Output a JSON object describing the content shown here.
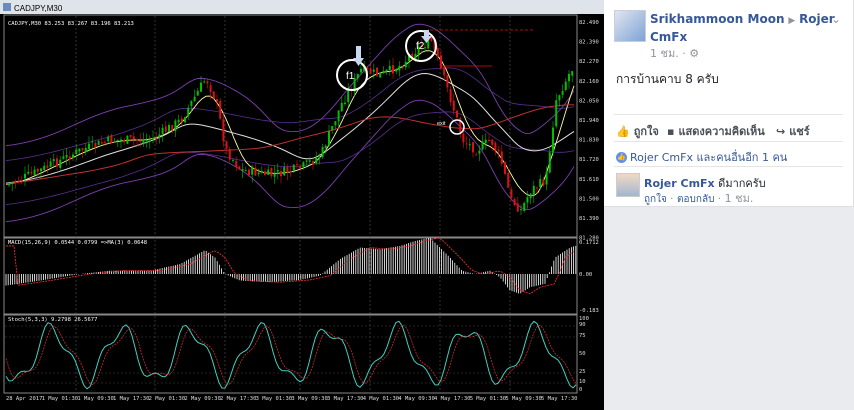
{
  "chart": {
    "window_title": "CADJPY,M30",
    "price_header": "CADJPY,M30 83.253 83.267 83.196 83.213",
    "price_axis": [
      "82.490",
      "82.390",
      "82.270",
      "82.160",
      "82.050",
      "81.940",
      "81.830",
      "81.720",
      "81.610",
      "81.500",
      "81.390",
      "81.280"
    ],
    "macd_label": "MACD(15,26,9) 0.0544 0.0799 =>MA(3) 0.0648",
    "macd_axis": [
      "0.1712",
      "0.00",
      "-0.183"
    ],
    "stoch_label": "Stoch(5,3,3) 9.2798 26.5677",
    "stoch_axis": [
      "100",
      "90",
      "75",
      "50",
      "25",
      "10",
      "0"
    ],
    "time_axis": [
      "28 Apr 2017",
      "1 May 01:30",
      "1 May 09:30",
      "1 May 17:30",
      "2 May 01:30",
      "2 May 09:30",
      "2 May 17:30",
      "3 May 01:30",
      "3 May 09:30",
      "3 May 17:30",
      "4 May 01:30",
      "4 May 09:30",
      "4 May 17:30",
      "5 May 01:30",
      "5 May 09:30",
      "5 May 17:30"
    ],
    "annotations": {
      "f1": "f1",
      "f2": "f2",
      "exit": "exit"
    },
    "colors": {
      "bull": "#00c000",
      "bear": "#e01010",
      "macd": "#ffffff",
      "stoch": "#40d0c0"
    }
  },
  "post": {
    "author": "Srikhammoon Moon",
    "target": "Rojer CmFx",
    "time": "1 ชม.",
    "text": "การบ้านคาบ 8 ครับ",
    "actions": {
      "like": "ถูกใจ",
      "comment": "แสดงความคิดเห็น",
      "share": "แชร์"
    },
    "reactions": "Rojer CmFx และคนอื่นอีก 1 คน",
    "comment": {
      "author": "Rojer CmFx",
      "text": "ดีมากครับ",
      "like": "ถูกใจ",
      "reply": "ตอบกลับ",
      "time": "1 ชม."
    }
  }
}
